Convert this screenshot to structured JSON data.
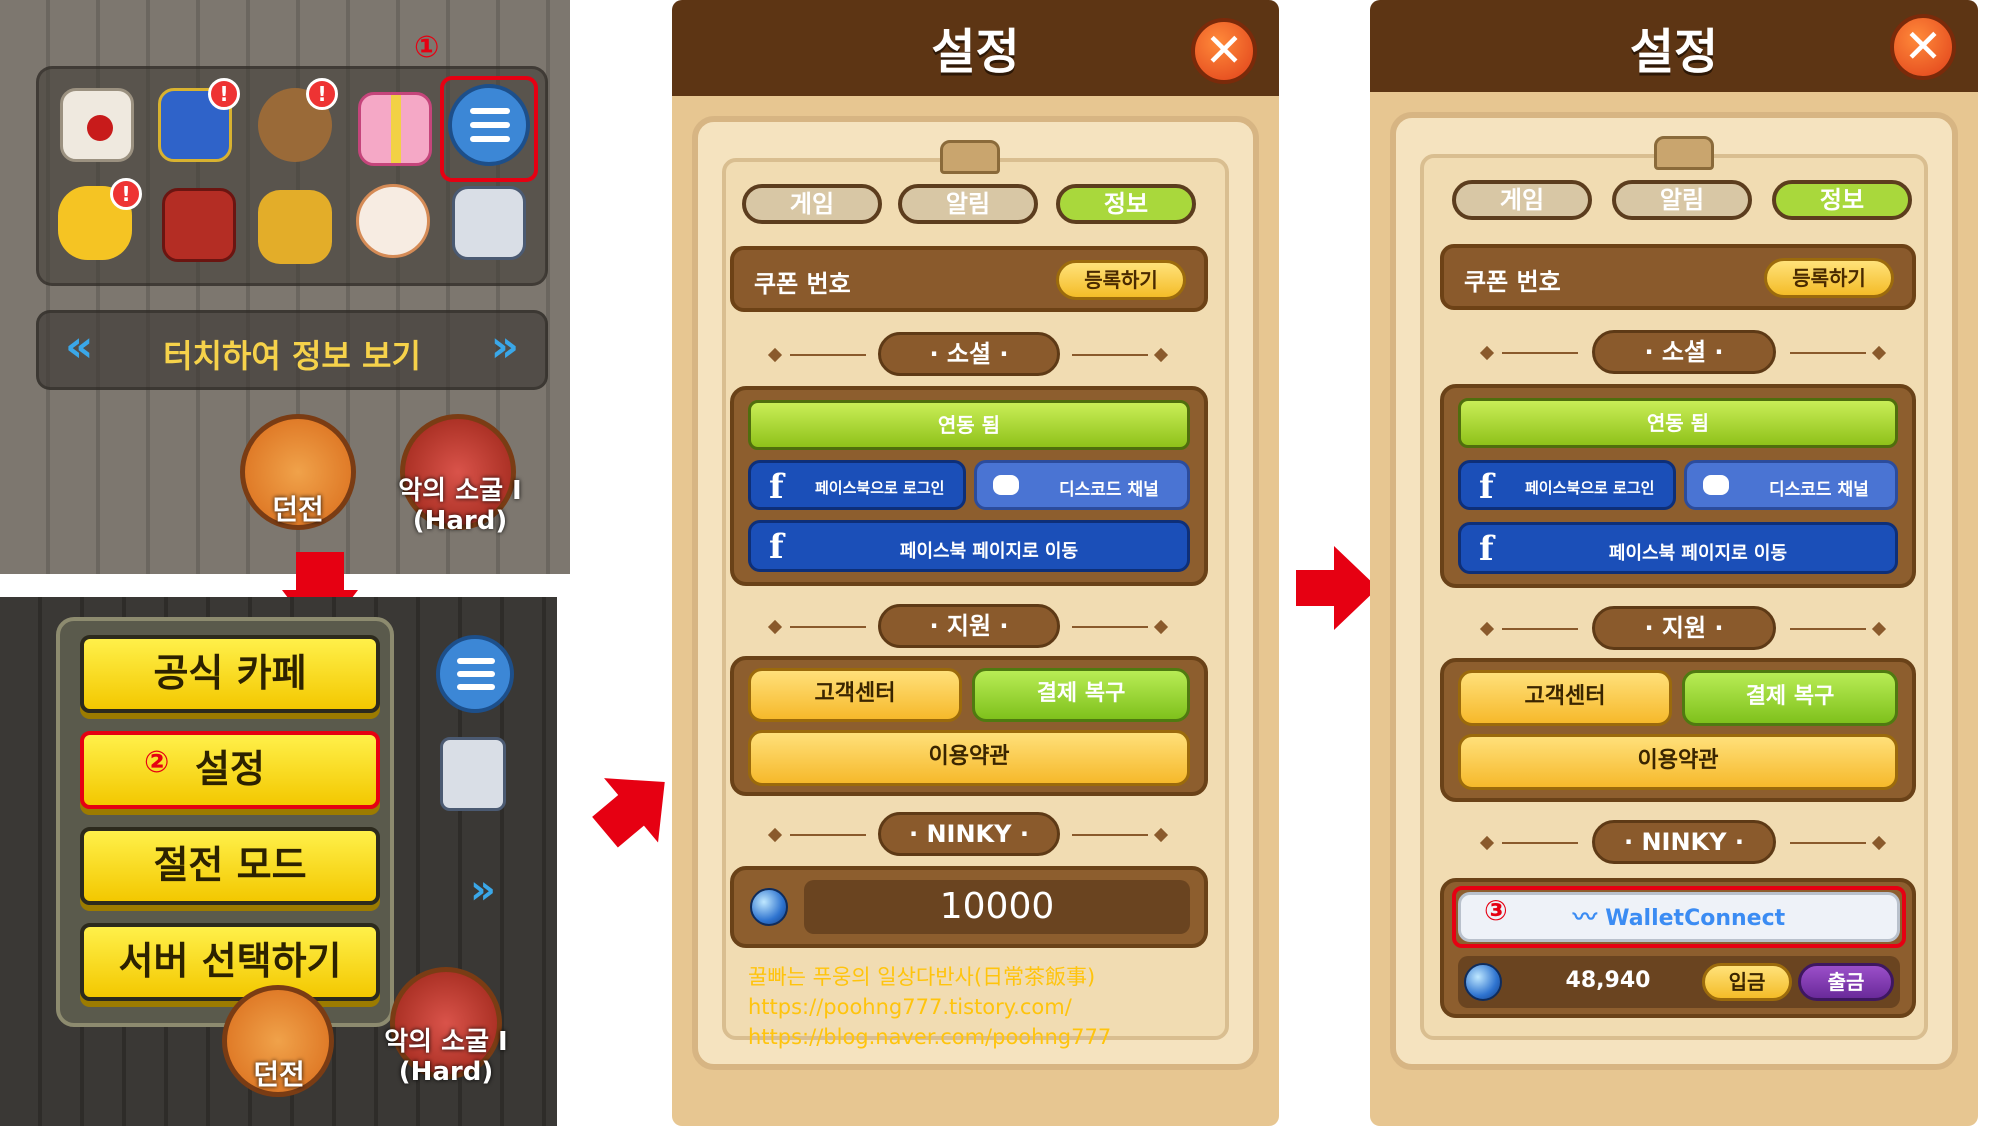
{
  "step_markers": {
    "one": "①",
    "two": "②",
    "three": "③"
  },
  "game_menu": {
    "info_bar": "터치하여 정보 보기",
    "nav_left": "«",
    "nav_right": "»",
    "dungeon_label": "던전",
    "cave_label_line1": "악의 소굴 I",
    "cave_label_line2": "(Hard)",
    "badge": "!"
  },
  "popup_menu": {
    "items": [
      "공식 카페",
      "설정",
      "절전 모드",
      "서버 선택하기"
    ],
    "dungeon_label": "던전",
    "cave_label_line1": "악의 소굴 I",
    "cave_label_line2": "(Hard)"
  },
  "settings": {
    "title": "설정",
    "close": "✕",
    "tabs": [
      "게임",
      "알림",
      "정보"
    ],
    "coupon_label": "쿠폰 번호",
    "register": "등록하기",
    "section_social": "· 소셜 ·",
    "linked": "연동 됨",
    "facebook_login": "페이스북으로 로그인",
    "discord": "디스코드 채널",
    "facebook_page": "페이스북 페이지로 이동",
    "section_support": "· 지원 ·",
    "customer_center": "고객센터",
    "payment_restore": "결제 복구",
    "terms": "이용약관",
    "section_ninky": "· NINKY ·"
  },
  "dialog_before": {
    "ninky_value": "10000"
  },
  "dialog_after": {
    "wallet_connect": "WalletConnect",
    "ninky_value": "48,940",
    "deposit": "입금",
    "withdraw": "출금"
  },
  "watermark": {
    "line1": "꿀빠는 푸웅의 일상다반사(日常茶飯事)",
    "line2": "https://poohng777.tistory.com/",
    "line3": "https://blog.naver.com/poohng777"
  },
  "colors": {
    "accent_red": "#e60012",
    "header_brown": "#5d3514",
    "active_tab_green": "#a9d83c"
  }
}
